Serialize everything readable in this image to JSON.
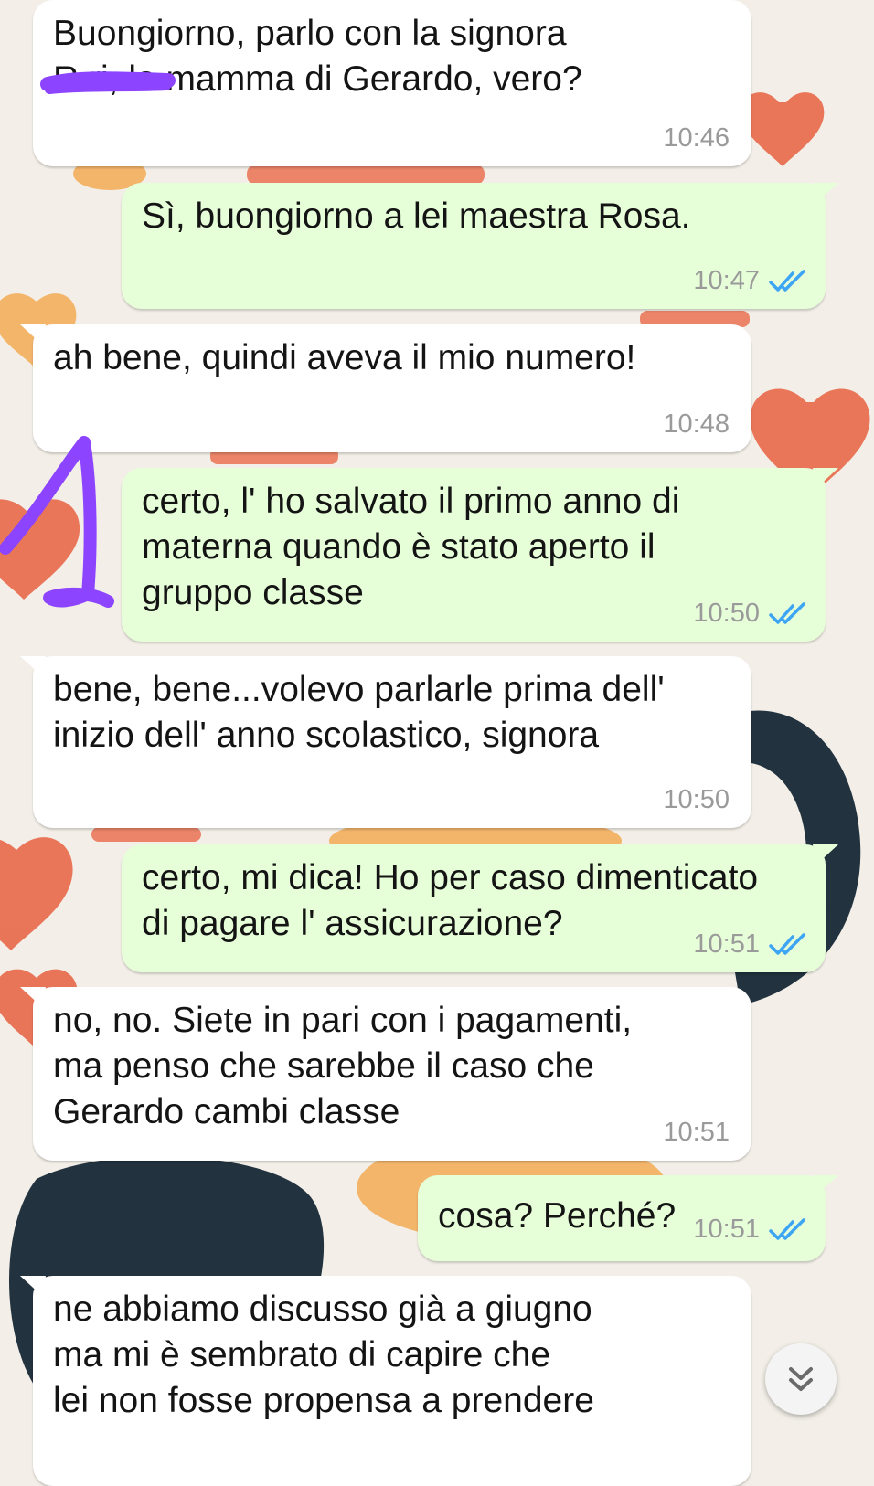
{
  "chat": {
    "messages": [
      {
        "direction": "incoming",
        "text": "Buongiorno, parlo con la signora\nR      ri, la mamma di Gerardo, vero?",
        "time": "10:46"
      },
      {
        "direction": "outgoing",
        "text": "Sì, buongiorno a lei maestra Rosa.",
        "time": "10:47",
        "status": "read"
      },
      {
        "direction": "incoming",
        "text": "ah bene, quindi aveva il mio numero!",
        "time": "10:48"
      },
      {
        "direction": "outgoing",
        "text": "certo, l' ho salvato il primo anno di\nmaterna quando è stato aperto il\ngruppo classe",
        "time": "10:50",
        "status": "read"
      },
      {
        "direction": "incoming",
        "text": "bene, bene...volevo parlarle prima dell'\ninizio dell' anno scolastico, signora",
        "time": "10:50"
      },
      {
        "direction": "outgoing",
        "text": "certo, mi dica! Ho per caso dimenticato\ndi pagare l' assicurazione?",
        "time": "10:51",
        "status": "read"
      },
      {
        "direction": "incoming",
        "text": "no, no. Siete in pari con i pagamenti,\nma penso che sarebbe il caso che\nGerardo cambi classe",
        "time": "10:51"
      },
      {
        "direction": "outgoing",
        "text": "cosa? Perché?",
        "time": "10:51",
        "status": "read"
      },
      {
        "direction": "incoming",
        "text": "ne abbiamo discusso già a giugno\nma mi è sembrato di capire che\nlei non fosse propensa a prendere",
        "time": ""
      }
    ]
  },
  "icons": {
    "read_receipt": "double-check-icon",
    "scroll_down": "chevron-double-down-icon"
  },
  "colors": {
    "incoming_bubble": "#ffffff",
    "outgoing_bubble": "#e7ffd9",
    "read_ticks": "#3da5f4",
    "annotation_purple": "#8d44ff",
    "heart_red": "#e8603f"
  }
}
